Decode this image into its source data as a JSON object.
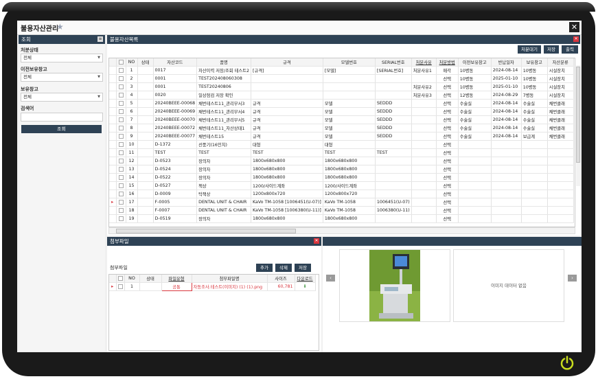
{
  "window": {
    "title": "불용자산관리",
    "close": "✕"
  },
  "search_panel": {
    "header": "조회",
    "filters": [
      {
        "label": "처분상태",
        "value": "전체"
      },
      {
        "label": "이전보유창고",
        "value": "전체"
      },
      {
        "label": "보유창고",
        "value": "전체"
      }
    ],
    "keyword_label": "검색어",
    "keyword_value": "",
    "search_button": "조회"
  },
  "list_panel": {
    "header": "불용자산목록",
    "buttons": {
      "dispose_wait": "처분대기",
      "save": "저장",
      "print": "출력"
    },
    "columns": [
      "",
      "NO",
      "상태",
      "자산코드",
      "품명",
      "규격",
      "모델번호",
      "SERIAL번호",
      "처분사유",
      "처분방법",
      "이전보유창고",
      "반납일자",
      "보유창고",
      "자산분류"
    ],
    "rows": [
      [
        "",
        "1",
        "",
        "0017",
        "자산이력 저장/조회 테스트2",
        "[규격]",
        "[모델]",
        "[SERIAL번호]",
        "처분사유1",
        "매각",
        "10병동",
        "2024-08-14",
        "10병동",
        "시설장치"
      ],
      [
        "",
        "2",
        "",
        "0001",
        "TEST202408060308",
        "",
        "",
        "",
        "",
        "선택",
        "10병동",
        "2025-01-10",
        "10병동",
        "시설장치"
      ],
      [
        "",
        "3",
        "",
        "0001",
        "TEST20240806",
        "",
        "",
        "",
        "처분사유2",
        "선택",
        "10병동",
        "2025-01-10",
        "10병동",
        "시설장치"
      ],
      [
        "",
        "4",
        "",
        "0020",
        "일상점검 저장 확인",
        "",
        "",
        "",
        "처분사유3",
        "선택",
        "12병동",
        "2024-08-29",
        "7병동",
        "시설장치"
      ],
      [
        "",
        "5",
        "",
        "20240BEEE-00068",
        "채번테스트11_관리부서3",
        "규격",
        "모델",
        "SEDDD",
        "",
        "선택",
        "수술실",
        "2024-08-14",
        "수술실",
        "채번클래"
      ],
      [
        "",
        "6",
        "",
        "20240BEEE-00069",
        "채번테스트11_관리부서4",
        "규격",
        "모델",
        "SEDDD",
        "",
        "선택",
        "수술실",
        "2024-08-14",
        "수술실",
        "채번클래"
      ],
      [
        "",
        "7",
        "",
        "20240BEEE-00070",
        "채번테스트11_관리부서5",
        "규격",
        "모델",
        "SEDDD",
        "",
        "선택",
        "수술실",
        "2024-08-14",
        "수술실",
        "채번클래"
      ],
      [
        "",
        "8",
        "",
        "20240BEEE-00072",
        "채번테스트11_자산상태1",
        "규격",
        "모델",
        "SEDDD",
        "",
        "선택",
        "수술실",
        "2024-08-14",
        "수술실",
        "채번클래"
      ],
      [
        "",
        "9",
        "",
        "20240BEEE-00077",
        "채번테스트15",
        "규격",
        "모델",
        "SEDDD",
        "",
        "선택",
        "수술실",
        "2024-08-14",
        "보급계",
        "채번클래"
      ],
      [
        "",
        "10",
        "",
        "D-1372",
        "선풍기(16인치)",
        "대형",
        "대형",
        "",
        "",
        "선택",
        "",
        "",
        "",
        ""
      ],
      [
        "",
        "11",
        "",
        "TEST",
        "TEST",
        "TEST",
        "TEST",
        "TEST",
        "",
        "선택",
        "",
        "",
        "",
        ""
      ],
      [
        "",
        "12",
        "",
        "D-0523",
        "장의자",
        "1800x680x800",
        "1800x680x800",
        "",
        "",
        "선택",
        "",
        "",
        "",
        ""
      ],
      [
        "",
        "13",
        "",
        "D-0524",
        "장의자",
        "1800x680x800",
        "1800x680x800",
        "",
        "",
        "선택",
        "",
        "",
        "",
        ""
      ],
      [
        "",
        "14",
        "",
        "D-0522",
        "장의자",
        "1800x680x800",
        "1800x680x800",
        "",
        "",
        "선택",
        "",
        "",
        "",
        ""
      ],
      [
        "",
        "15",
        "",
        "D-0527",
        "책상",
        "1200/사이드계좌",
        "1200/사이드계좌",
        "",
        "",
        "선택",
        "",
        "",
        "",
        ""
      ],
      [
        "",
        "16",
        "",
        "D-0009",
        "탁책상",
        "1200x800x720",
        "1200x800x720",
        "",
        "",
        "선택",
        "",
        "",
        "",
        ""
      ],
      [
        "▸",
        "17",
        "",
        "F-0005",
        "DENTAL UNIT & CHAIR",
        "KaVo TM-1058 [1006451(U-07)]",
        "KaVo TM-1058",
        "1006451(U-07)",
        "",
        "선택",
        "",
        "",
        "",
        ""
      ],
      [
        "",
        "18",
        "",
        "F-0007",
        "DENTAL UNIT & CHAIR",
        "KaVo TM-1058 [1006380(U-11)]",
        "KaVo TM-1058",
        "1006380(U-11)",
        "",
        "선택",
        "",
        "",
        "",
        ""
      ],
      [
        "",
        "19",
        "",
        "D-0519",
        "장의자",
        "1800x680x800",
        "1800x680x800",
        "",
        "",
        "선택",
        "",
        "",
        "",
        ""
      ]
    ]
  },
  "attachment_panel": {
    "header": "첨부파일",
    "section_label": "첨부파일",
    "buttons": {
      "add": "추가",
      "delete": "삭제",
      "save": "저장"
    },
    "columns": [
      "",
      "NO",
      "상태",
      "파일유형",
      "첨부파일명",
      "사이즈",
      "다운로드"
    ],
    "rows": [
      {
        "marker": "▸",
        "no": "1",
        "status": "",
        "type": "공통",
        "name": "자동조사.테스트(이미지) (1) (1).png",
        "size": "60,781"
      }
    ]
  },
  "preview_panel": {
    "no_image_text": "이미지 데이터 없음",
    "prev": "‹",
    "next": "›"
  },
  "colors": {
    "header_bg": "#2e4255",
    "accent_red": "#d9363e",
    "bezel": "#1a1a1a",
    "power": "#c8dc1e"
  }
}
